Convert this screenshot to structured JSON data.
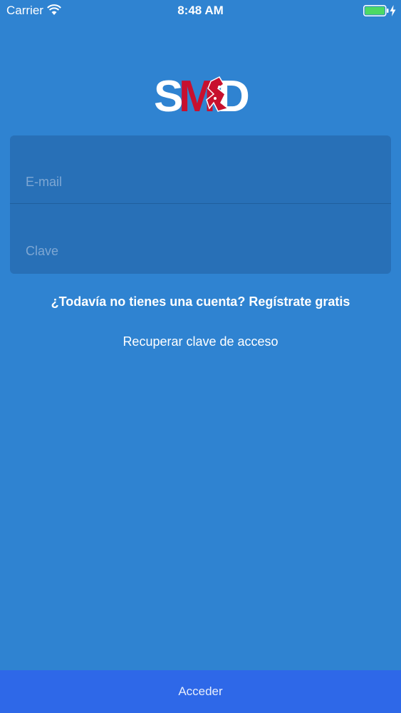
{
  "status_bar": {
    "carrier": "Carrier",
    "time": "8:48 AM",
    "icons": [
      "wifi-icon",
      "battery-icon",
      "charging-bolt-icon"
    ],
    "battery_color": "#4cd964"
  },
  "logo": {
    "text": "SMD",
    "colors": {
      "white": "#ffffff",
      "red": "#c8102e"
    }
  },
  "form": {
    "email_placeholder": "E-mail",
    "email_value": "",
    "password_placeholder": "Clave",
    "password_value": ""
  },
  "links": {
    "register": "¿Todavía no tienes una cuenta? Regístrate gratis",
    "recover": "Recuperar clave de acceso"
  },
  "submit": {
    "label": "Acceder"
  },
  "colors": {
    "background": "#2f83d1",
    "form_card": "#2870b7",
    "button": "#2e68e8"
  }
}
